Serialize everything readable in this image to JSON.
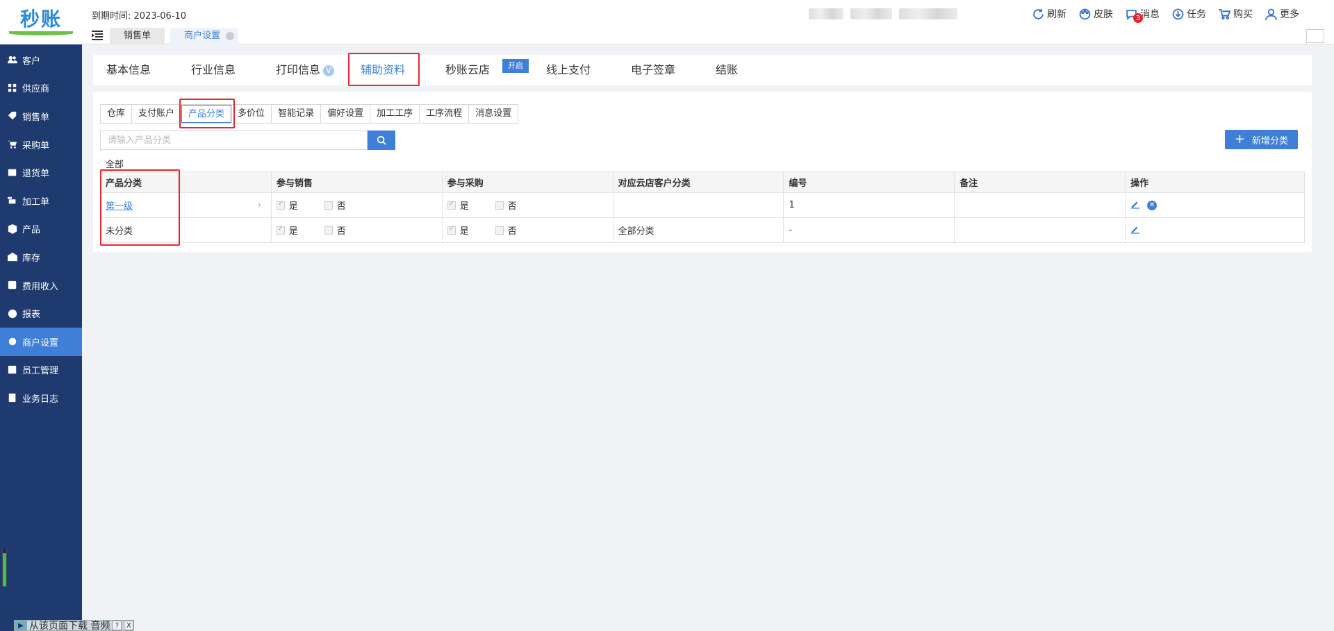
{
  "app": {
    "logo_text": "秒账",
    "expire_text": "到期时间: 2023-06-10"
  },
  "sidebar": {
    "items": [
      {
        "label": "客户",
        "icon": "users-icon"
      },
      {
        "label": "供应商",
        "icon": "supplier-icon"
      },
      {
        "label": "销售单",
        "icon": "tag-icon"
      },
      {
        "label": "采购单",
        "icon": "cart-icon"
      },
      {
        "label": "退货单",
        "icon": "return-icon"
      },
      {
        "label": "加工单",
        "icon": "process-icon"
      },
      {
        "label": "产品",
        "icon": "box-icon"
      },
      {
        "label": "库存",
        "icon": "warehouse-icon"
      },
      {
        "label": "费用收入",
        "icon": "money-icon"
      },
      {
        "label": "报表",
        "icon": "pie-chart-icon"
      },
      {
        "label": "商户设置",
        "icon": "gear-icon"
      },
      {
        "label": "员工管理",
        "icon": "staff-icon"
      },
      {
        "label": "业务日志",
        "icon": "log-icon"
      }
    ],
    "active_index": 10,
    "scroll_level": 0.85
  },
  "top_actions": [
    {
      "label": "刷新",
      "icon": "refresh-icon"
    },
    {
      "label": "皮肤",
      "icon": "palette-icon"
    },
    {
      "label": "消息",
      "icon": "message-icon",
      "badge": "3"
    },
    {
      "label": "任务",
      "icon": "task-icon"
    },
    {
      "label": "购买",
      "icon": "cart-icon"
    },
    {
      "label": "更多",
      "icon": "user-icon"
    }
  ],
  "page_tabs": [
    {
      "label": "销售单"
    },
    {
      "label": "商户设置",
      "active": true
    }
  ],
  "settings_tabs": [
    {
      "label": "基本信息"
    },
    {
      "label": "行业信息"
    },
    {
      "label": "打印信息",
      "badge": "V"
    },
    {
      "label": "辅助资料",
      "active": true
    },
    {
      "label": "秒账云店",
      "badge": "开启"
    },
    {
      "label": "线上支付"
    },
    {
      "label": "电子签章"
    },
    {
      "label": "结账"
    }
  ],
  "sub_tabs": [
    {
      "label": "仓库"
    },
    {
      "label": "支付账户"
    },
    {
      "label": "产品分类",
      "active": true
    },
    {
      "label": "多价位"
    },
    {
      "label": "智能记录"
    },
    {
      "label": "偏好设置"
    },
    {
      "label": "加工工序"
    },
    {
      "label": "工序流程"
    },
    {
      "label": "消息设置"
    }
  ],
  "search": {
    "placeholder": "请输入产品分类",
    "value": ""
  },
  "add_button": {
    "label": "新增分类"
  },
  "all_label": "全部",
  "table": {
    "headers": [
      "产品分类",
      "",
      "参与销售",
      "参与采购",
      "对应云店客户分类",
      "编号",
      "备注",
      "操作"
    ],
    "yes": "是",
    "no": "否",
    "rows": [
      {
        "category": "第一级",
        "is_link": true,
        "has_arrow": true,
        "sale_yes": true,
        "purchase_yes": true,
        "cloud_category": "",
        "code": "1",
        "remark": "",
        "deletable": true
      },
      {
        "category": "未分类",
        "is_link": false,
        "has_arrow": false,
        "sale_yes": true,
        "purchase_yes": true,
        "cloud_category": "全部分类",
        "code": "-",
        "remark": "",
        "deletable": false
      }
    ]
  },
  "media_bar": {
    "label": "从该页面下载 音频",
    "help": "?",
    "close": "X"
  },
  "colors": {
    "accent": "#3f7fd8",
    "sidebar": "#1e3a6e",
    "highlight": "#e8242f"
  }
}
